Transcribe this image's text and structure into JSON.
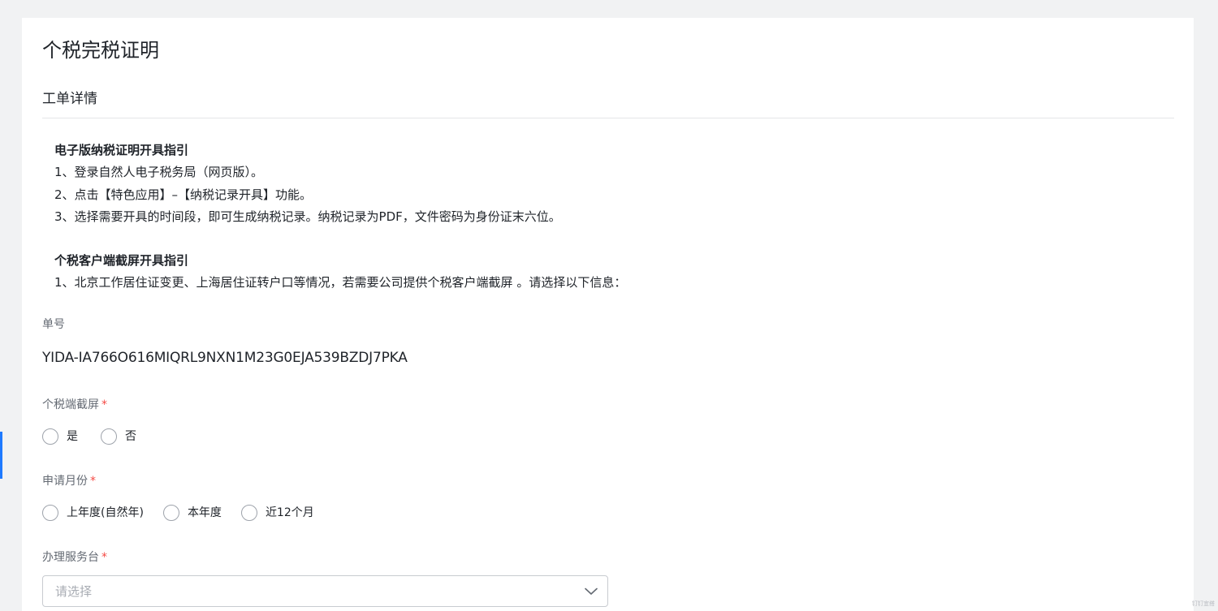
{
  "page": {
    "title": "个税完税证明",
    "section_title": "工单详情"
  },
  "guide": {
    "electronic_heading": "电子版纳税证明开具指引",
    "electronic_steps": [
      "1、登录自然人电子税务局（网页版）。",
      "2、点击【特色应用】–【纳税记录开具】功能。",
      "3、选择需要开具的时间段，即可生成纳税记录。纳税记录为PDF，文件密码为身份证末六位。"
    ],
    "screenshot_heading": "个税客户端截屏开具指引",
    "screenshot_steps": [
      "1、北京工作居住证变更、上海居住证转户口等情况，若需要公司提供个税客户端截屏 。请选择以下信息："
    ]
  },
  "form": {
    "order_no": {
      "label": "单号",
      "value": "YIDA-IA766O616MIQRL9NXN1M23G0EJA539BZDJ7PKA"
    },
    "screenshot": {
      "label": "个税端截屏",
      "required_mark": "*",
      "options": [
        "是",
        "否"
      ]
    },
    "apply_month": {
      "label": "申请月份",
      "required_mark": "*",
      "options": [
        "上年度(自然年)",
        "本年度",
        "近12个月"
      ]
    },
    "service_desk": {
      "label": "办理服务台",
      "required_mark": "*",
      "placeholder": "请选择"
    }
  },
  "footer": {
    "corner_text": "钉钉宜搭"
  },
  "colors": {
    "accent": "#1f7aff",
    "required": "#f54a45",
    "label": "#646a73"
  }
}
